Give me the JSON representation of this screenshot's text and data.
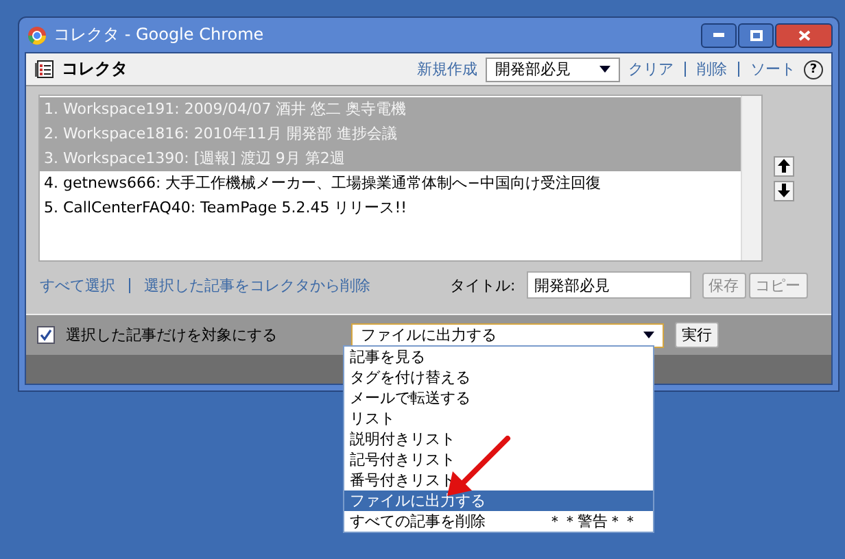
{
  "window": {
    "title": "コレクタ - Google Chrome"
  },
  "header": {
    "title": "コレクタ",
    "new_link": "新規作成",
    "collection_select": "開発部必見",
    "links": [
      "クリア",
      "削除",
      "ソート"
    ],
    "help": "?"
  },
  "articles": [
    {
      "text": "1. Workspace191: 2009/04/07 酒井 悠二 奥寺電機",
      "selected": true
    },
    {
      "text": "2. Workspace1816: 2010年11月 開発部 進捗会議",
      "selected": true
    },
    {
      "text": "3. Workspace1390: [週報] 渡辺 9月 第2週",
      "selected": true
    },
    {
      "text": "4. getnews666: 大手工作機械メーカー、工場操業通常体制へ−中国向け受注回復",
      "selected": false
    },
    {
      "text": "5. CallCenterFAQ40: TeamPage 5.2.45 リリース!!",
      "selected": false
    }
  ],
  "actions": {
    "select_all": "すべて選択",
    "remove_selected": "選択した記事をコレクタから削除",
    "title_label": "タイトル:",
    "title_value": "開発部必見",
    "save": "保存",
    "save_disabled": true,
    "copy": "コピー",
    "copy_disabled": true
  },
  "bottom": {
    "only_selected": {
      "label": "選択した記事だけを対象にする",
      "checked": true
    },
    "action_select": "ファイルに出力する",
    "run": "実行"
  },
  "action_options": [
    {
      "label": "記事を見る",
      "selected": false
    },
    {
      "label": "タグを付け替える",
      "selected": false
    },
    {
      "label": "メールで転送する",
      "selected": false
    },
    {
      "label": "リスト",
      "selected": false
    },
    {
      "label": "説明付きリスト",
      "selected": false
    },
    {
      "label": "記号付きリスト",
      "selected": false
    },
    {
      "label": "番号付きリスト",
      "selected": false
    },
    {
      "label": "ファイルに出力する",
      "selected": true
    },
    {
      "label": "すべての記事を削除",
      "note": "＊＊警告＊＊",
      "selected": false
    }
  ]
}
